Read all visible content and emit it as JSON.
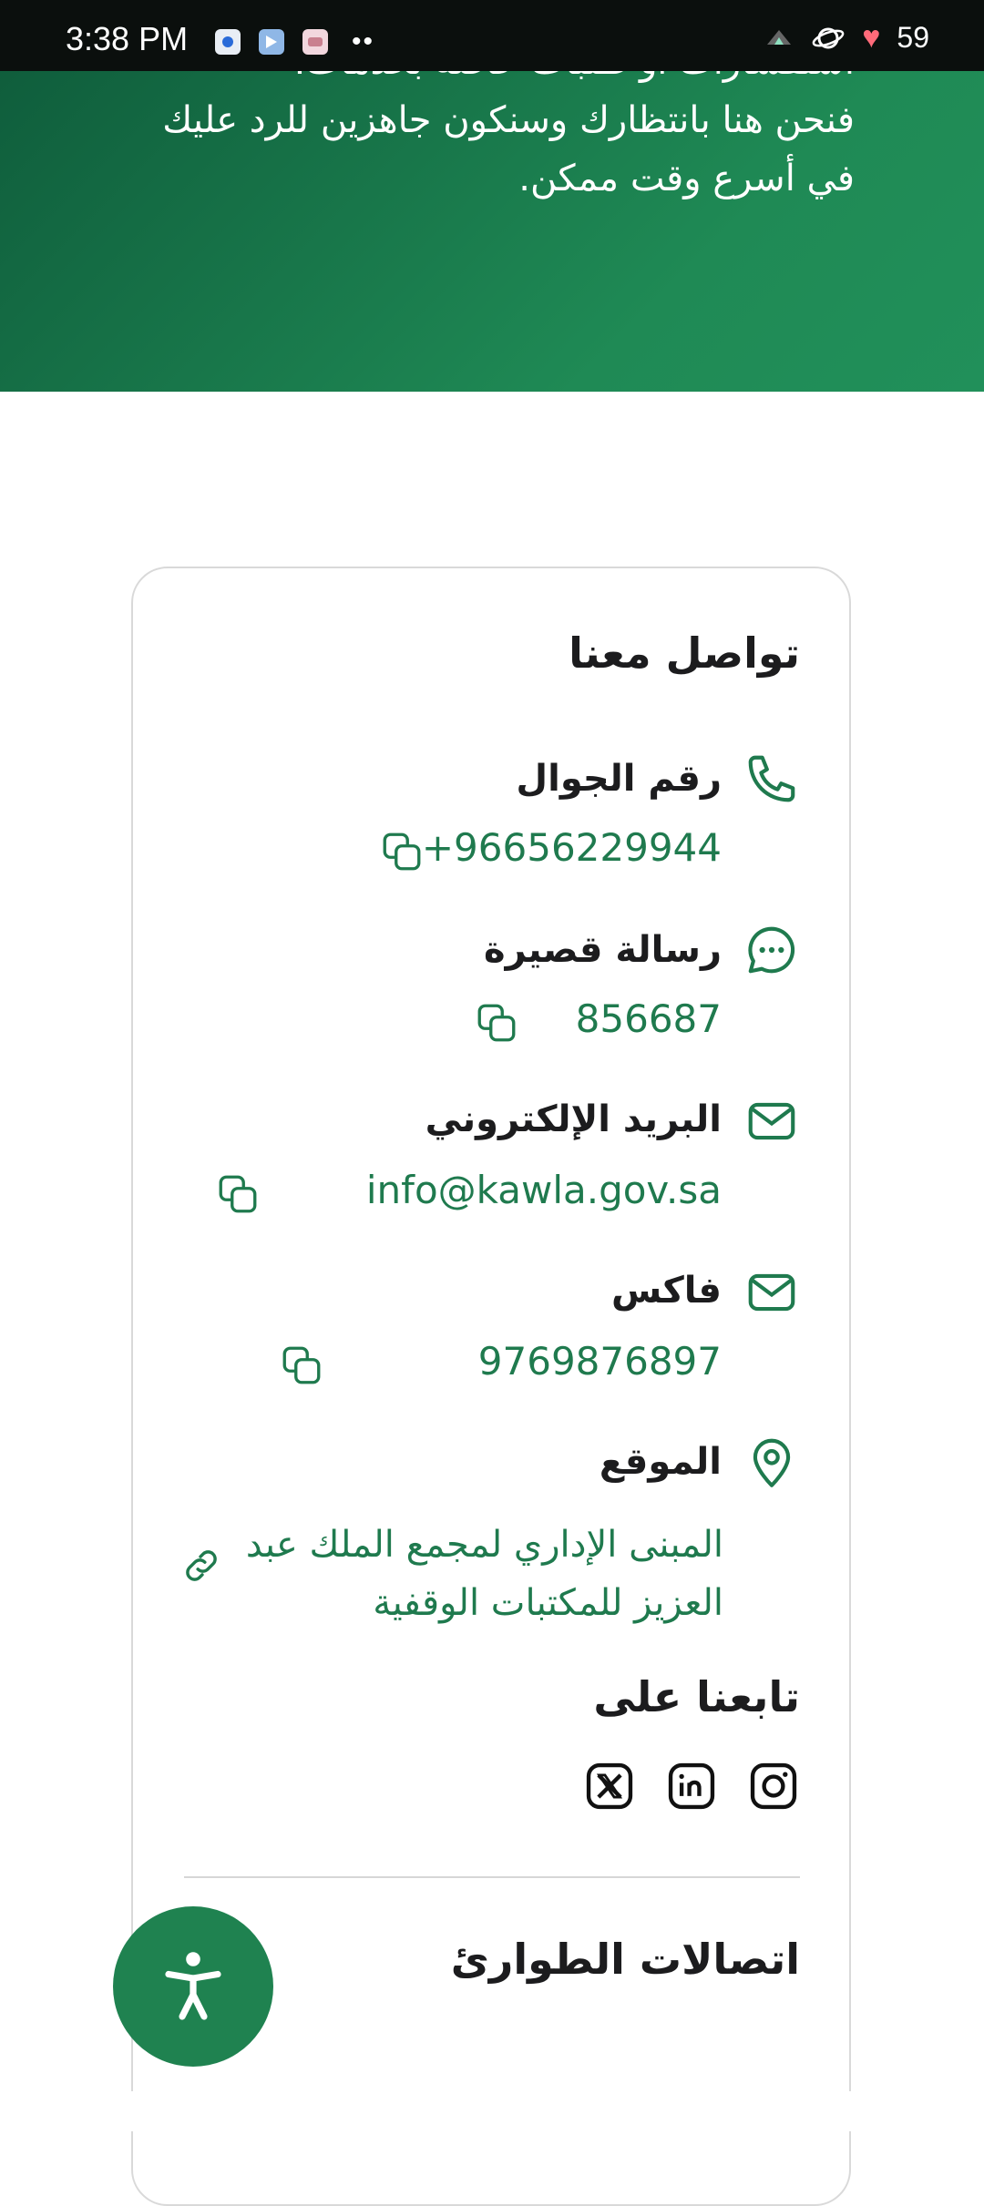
{
  "status_bar": {
    "time": "3:38 PM",
    "battery": "59",
    "left_icons": [
      "signal-app-icon",
      "telegram-icon",
      "gallery-app-icon"
    ],
    "overflow": "••"
  },
  "hero": {
    "lines": [
      "استفسارات أو طلبات خاصة بخدمات.",
      "فنحن هنا بانتظارك وسنكون جاهزين للرد عليك",
      "في أسرع وقت ممكن."
    ]
  },
  "contact": {
    "heading": "تواصل معنا",
    "mobile": {
      "label": "رقم الجوال",
      "value": "+96656229944",
      "icon": "phone-icon"
    },
    "sms": {
      "label": "رسالة قصيرة",
      "value": "856687",
      "icon": "chat-bubble-icon"
    },
    "email": {
      "label": "البريد الإلكتروني",
      "value": "info@kawla.gov.sa",
      "icon": "mail-icon"
    },
    "fax": {
      "label": "فاكس",
      "value": "9769876897",
      "icon": "mail-icon"
    },
    "location": {
      "label": "الموقع",
      "value": "المبنى الإداري لمجمع الملك عبد العزيز للمكتبات الوقفية",
      "icon": "map-pin-icon"
    }
  },
  "follow": {
    "heading": "تابعنا على",
    "networks": [
      "instagram-icon",
      "linkedin-icon",
      "x-icon"
    ]
  },
  "emergency": {
    "heading": "اتصالات الطوارئ"
  },
  "colors": {
    "brand_green": "#1f8250",
    "link_green": "#1f7a4e",
    "hero_dark": "#0e5a3a"
  }
}
